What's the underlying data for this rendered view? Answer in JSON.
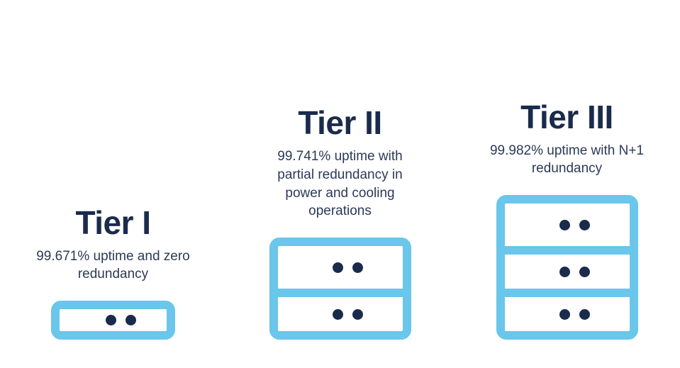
{
  "tiers": [
    {
      "title": "Tier I",
      "description": "99.671% uptime and zero redundancy",
      "units": 1
    },
    {
      "title": "Tier II",
      "description": "99.741% uptime with partial redundancy in power and cooling operations",
      "units": 2
    },
    {
      "title": "Tier III",
      "description": "99.982% uptime with N+1 redundancy",
      "units": 3
    }
  ],
  "colors": {
    "accent": "#6ac6ea",
    "text_dark": "#1a2b4c"
  }
}
